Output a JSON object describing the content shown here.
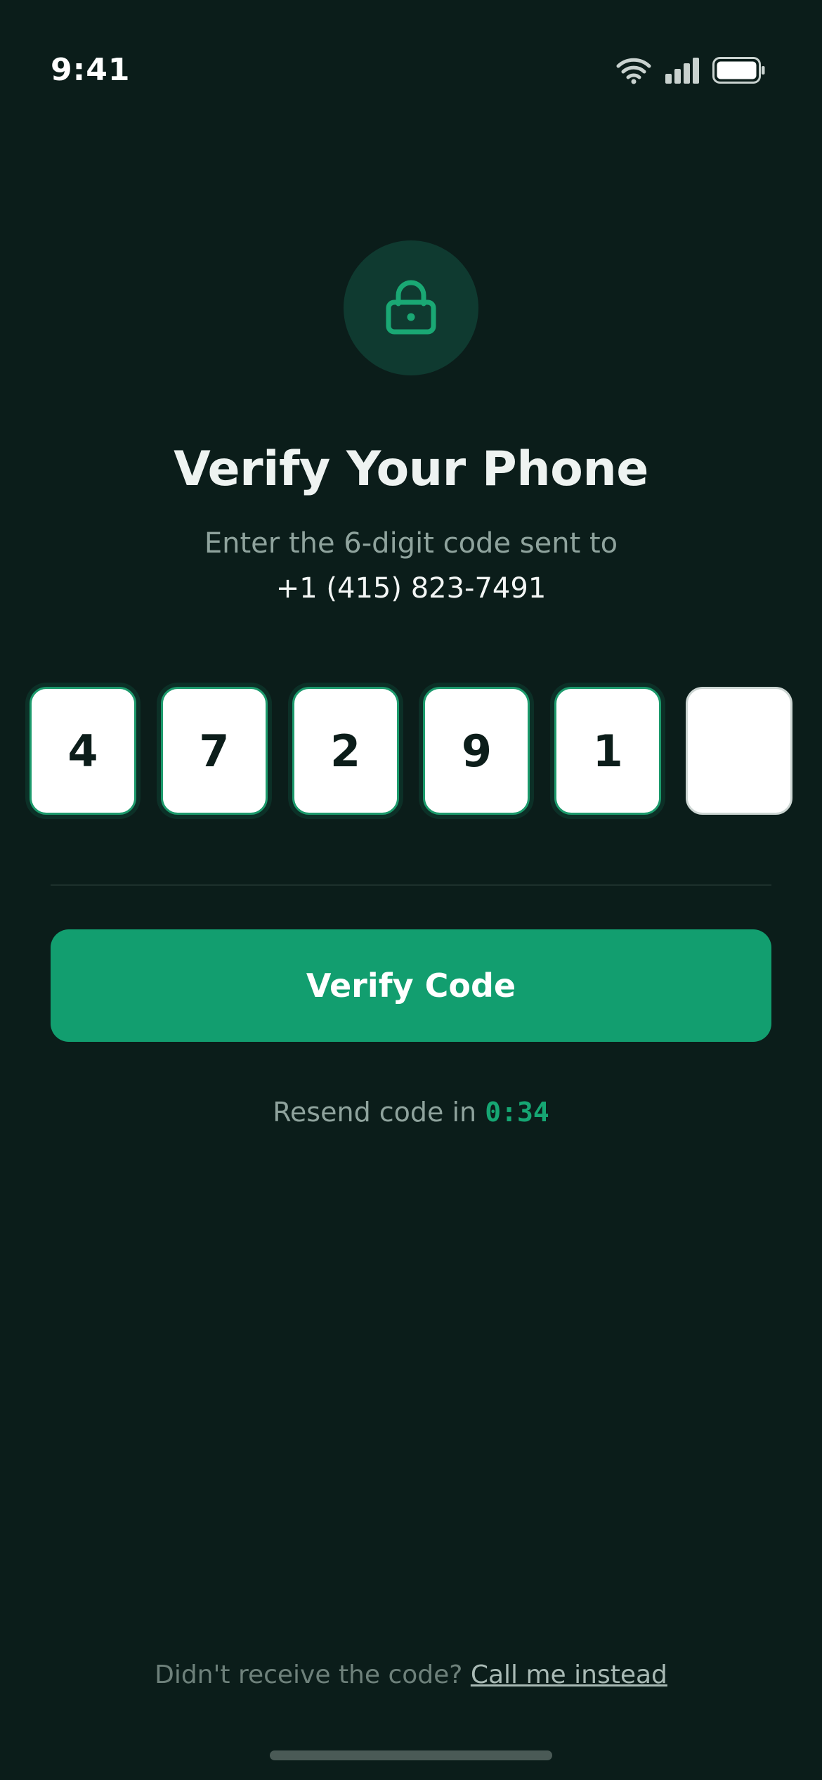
{
  "status_bar": {
    "time": "9:41",
    "icons": [
      "wifi-icon",
      "cellular-signal-icon",
      "battery-icon"
    ]
  },
  "header": {
    "icon": "lock-icon",
    "title": "Verify Your Phone",
    "subtitle": "Enter the 6-digit code sent to",
    "phone_number": "+1 (415) 823-7491"
  },
  "otp": {
    "length": 6,
    "digits": [
      "4",
      "7",
      "2",
      "9",
      "1",
      ""
    ]
  },
  "actions": {
    "verify_label": "Verify Code"
  },
  "resend": {
    "text": "Resend code in",
    "countdown": "0:34"
  },
  "footer": {
    "question": "Didn't receive the code?",
    "link_label": "Call me instead"
  },
  "colors": {
    "background": "#0b1d1a",
    "accent": "#129e6f",
    "muted_text": "#8fa39d",
    "lock_circle": "#0f3a30"
  }
}
